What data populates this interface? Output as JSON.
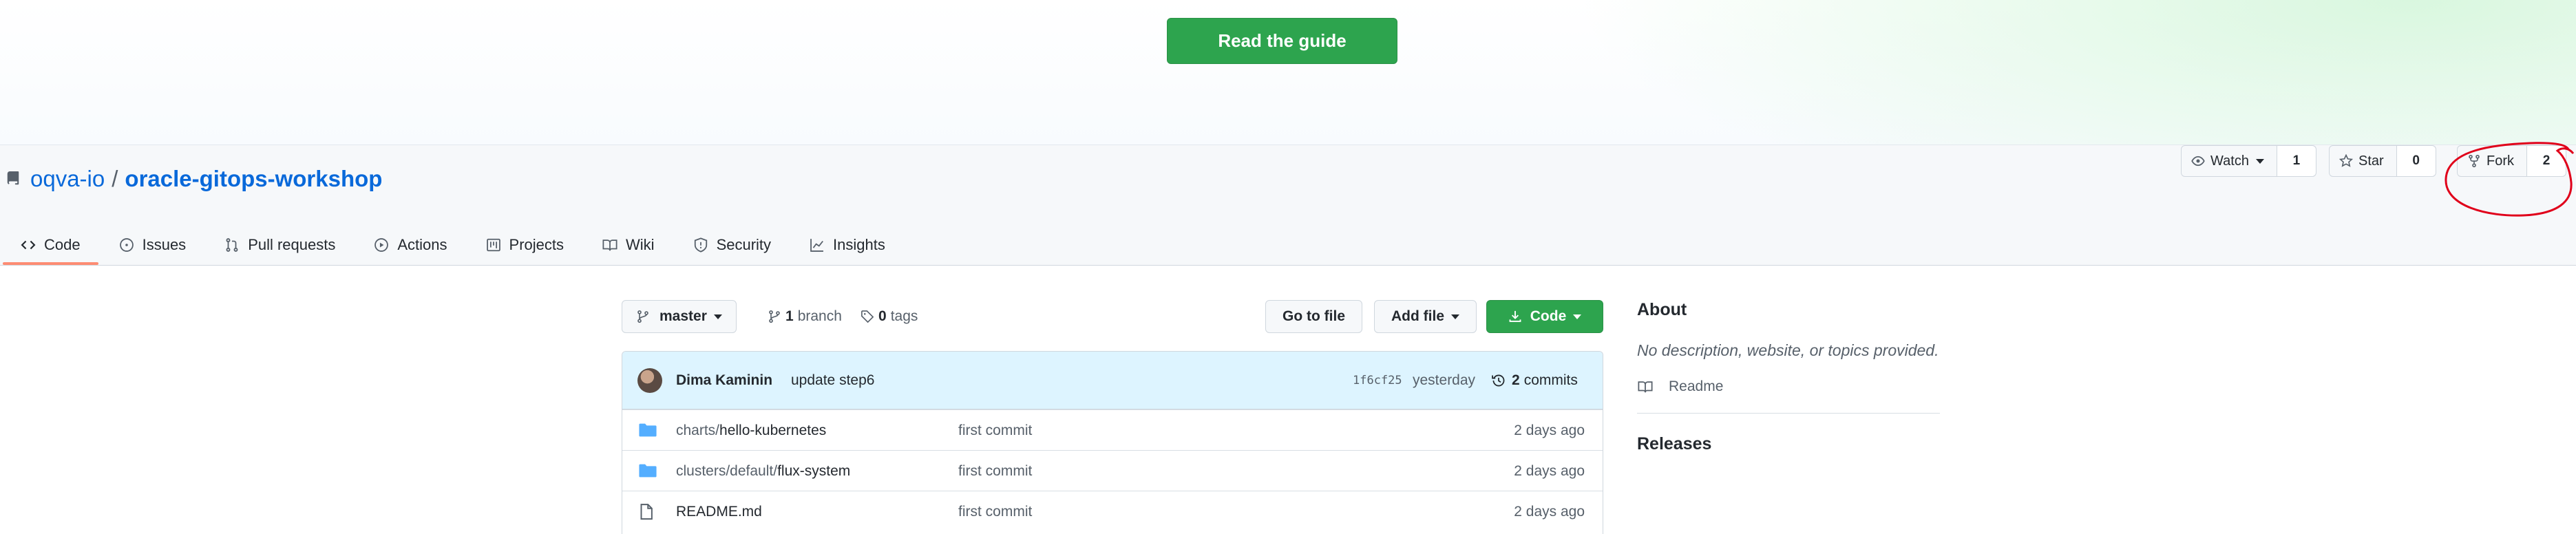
{
  "banner": {
    "guide_button": "Read the guide"
  },
  "repo": {
    "owner": "oqva-io",
    "separator": "/",
    "name": "oracle-gitops-workshop"
  },
  "repo_actions": {
    "watch": {
      "label": "Watch",
      "count": "1"
    },
    "star": {
      "label": "Star",
      "count": "0"
    },
    "fork": {
      "label": "Fork",
      "count": "2"
    }
  },
  "tabs": [
    {
      "label": "Code",
      "icon": "code-icon",
      "active": true
    },
    {
      "label": "Issues",
      "icon": "issue-icon"
    },
    {
      "label": "Pull requests",
      "icon": "pull-request-icon"
    },
    {
      "label": "Actions",
      "icon": "play-icon"
    },
    {
      "label": "Projects",
      "icon": "project-icon"
    },
    {
      "label": "Wiki",
      "icon": "book-icon"
    },
    {
      "label": "Security",
      "icon": "shield-icon"
    },
    {
      "label": "Insights",
      "icon": "graph-icon"
    }
  ],
  "branch_bar": {
    "branch": "master",
    "branch_count": "1",
    "branch_label": "branch",
    "tag_count": "0",
    "tag_label": "tags",
    "go_to_file": "Go to file",
    "add_file": "Add file",
    "code": "Code"
  },
  "latest_commit": {
    "author": "Dima Kaminin",
    "message": "update step6",
    "sha": "1f6cf25",
    "when": "yesterday",
    "commit_count": "2",
    "commit_label": "commits"
  },
  "files": [
    {
      "type": "folder",
      "path_prefix": "charts/",
      "name": "hello-kubernetes",
      "message": "first commit",
      "age": "2 days ago"
    },
    {
      "type": "folder",
      "path_prefix": "clusters/default/",
      "name": "flux-system",
      "message": "first commit",
      "age": "2 days ago"
    },
    {
      "type": "file",
      "path_prefix": "",
      "name": "README.md",
      "message": "first commit",
      "age": "2 days ago"
    }
  ],
  "about": {
    "heading": "About",
    "description": "No description, website, or topics provided.",
    "readme": "Readme",
    "releases_heading": "Releases"
  },
  "colors": {
    "accent_green": "#2da44e",
    "link_blue": "#0969da",
    "annotation_red": "#e0001a"
  }
}
